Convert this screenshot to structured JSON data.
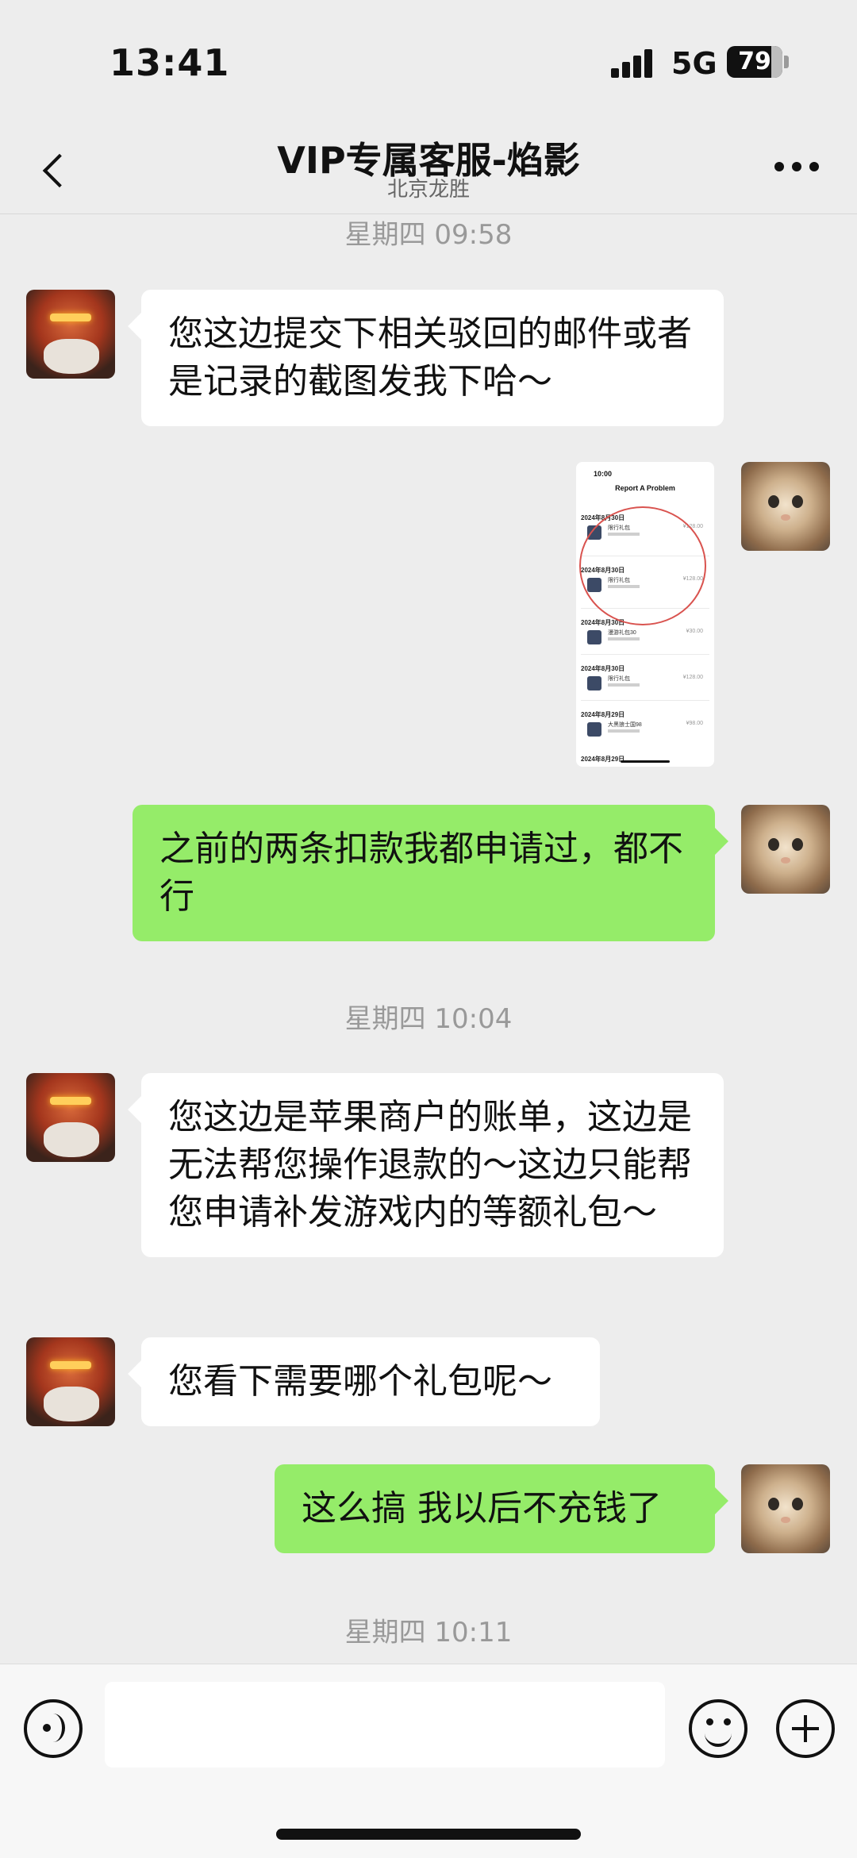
{
  "status_bar": {
    "time": "13:41",
    "network": "5G",
    "battery": "79"
  },
  "header": {
    "title": "VIP专属客服-焰影",
    "subtitle": "北京龙胜"
  },
  "messages": {
    "ts1": "星期四 09:58",
    "m1": "您这边提交下相关驳回的邮件或者是记录的截图发我下哈～",
    "m3": "之前的两条扣款我都申请过，都不行",
    "ts2": "星期四 10:04",
    "m4": "您这边是苹果商户的账单，这边是无法帮您操作退款的～这边只能帮您申请补发游戏内的等额礼包～",
    "m5": "您看下需要哪个礼包呢～",
    "m6": "这么搞 我以后不充钱了",
    "ts3": "星期四 10:11"
  },
  "screenshot_image": {
    "time": "10:00",
    "title": "Report A Problem",
    "rows": [
      {
        "date": "2024年8月30日",
        "item": "限行礼包",
        "price": "¥128.00"
      },
      {
        "date": "2024年8月30日",
        "item": "限行礼包",
        "price": "¥128.00"
      },
      {
        "date": "2024年8月30日",
        "item": "漫游礼包30",
        "price": "¥30.00"
      },
      {
        "date": "2024年8月30日",
        "item": "限行礼包",
        "price": "¥128.00"
      },
      {
        "date": "2024年8月29日",
        "item": "大黑狼士国98",
        "price": "¥98.00"
      },
      {
        "date": "2024年8月29日"
      }
    ]
  },
  "colors": {
    "background": "#ededed",
    "bubble_left": "#ffffff",
    "bubble_right": "#95ec69",
    "timestamp": "#999999"
  }
}
